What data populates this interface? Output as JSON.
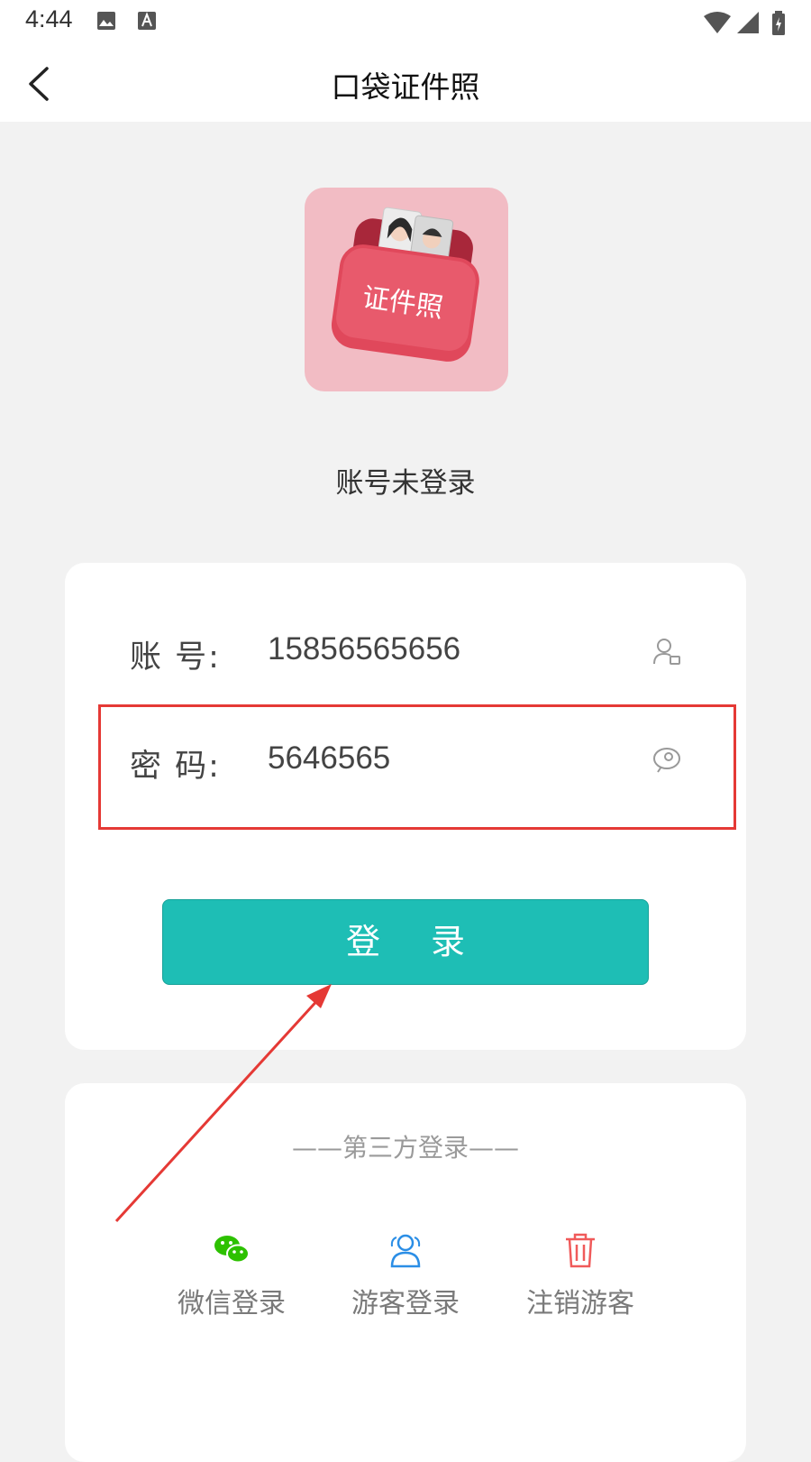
{
  "status_bar": {
    "time": "4:44"
  },
  "header": {
    "title": "口袋证件照",
    "back_icon": "chevron-left-icon"
  },
  "logo": {
    "text": "证件照"
  },
  "login_status": "账号未登录",
  "form": {
    "account_label": "账 号:",
    "account_value": "15856565656",
    "account_icon": "user-icon",
    "password_label": "密 码:",
    "password_value": "5646565",
    "password_icon": "eye-icon",
    "login_button": "登 录"
  },
  "third_party": {
    "title": "——第三方登录——",
    "options": [
      {
        "label": "微信登录",
        "icon": "wechat-icon",
        "color": "#2dc100"
      },
      {
        "label": "游客登录",
        "icon": "guest-icon",
        "color": "#2b8ee6"
      },
      {
        "label": "注销游客",
        "icon": "trash-icon",
        "color": "#f05a5a"
      }
    ]
  },
  "colors": {
    "accent": "#1ebeb5",
    "highlight": "#e53935"
  }
}
